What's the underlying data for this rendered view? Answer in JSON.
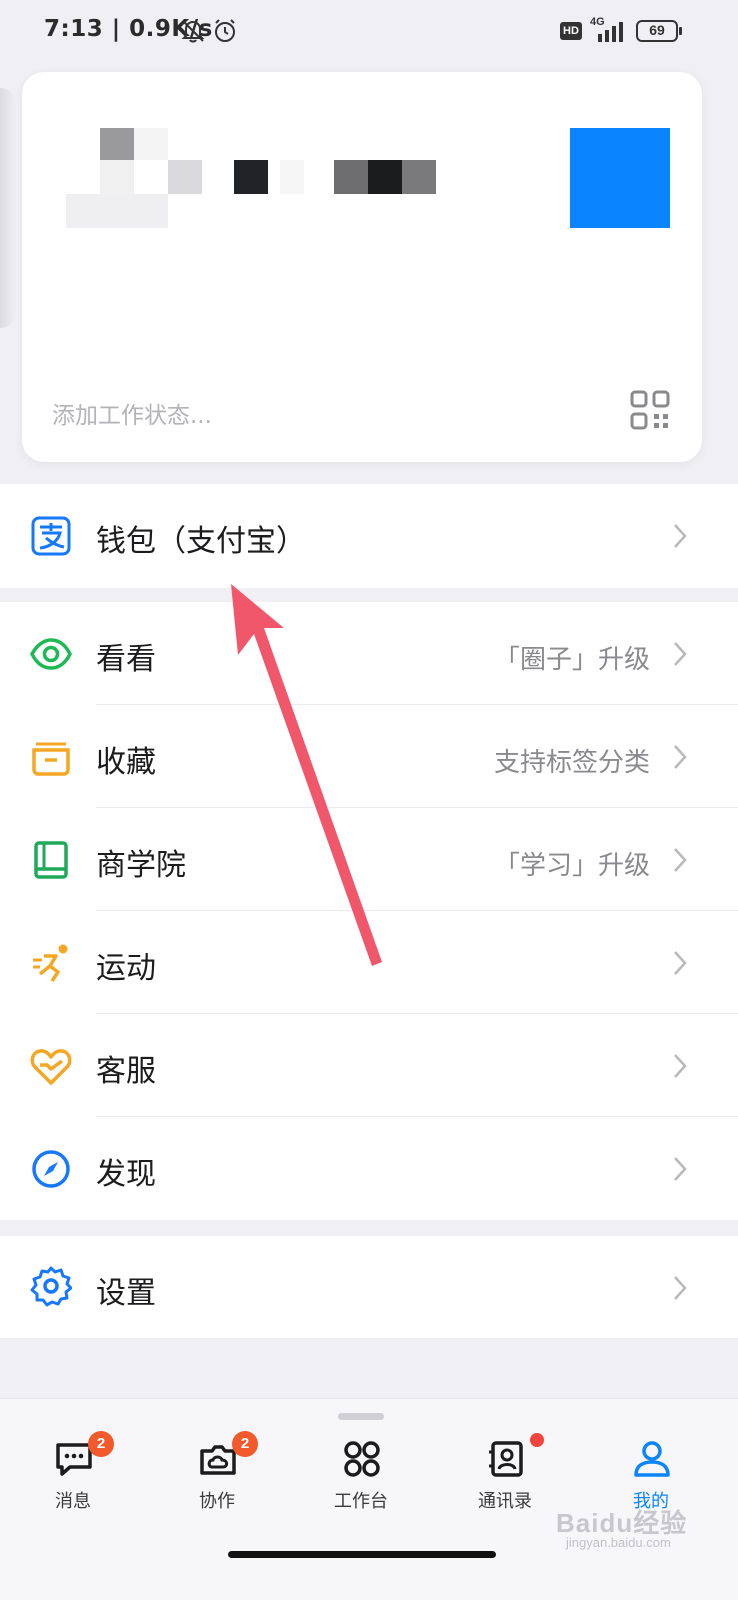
{
  "status_bar": {
    "time_speed": "7:13 | 0.9K/s",
    "hd": "HD",
    "network": "4G",
    "battery": "69"
  },
  "profile": {
    "status_placeholder": "添加工作状态...",
    "avatar_color": "#0a84ff"
  },
  "wallet_section": {
    "items": [
      {
        "label": "钱包（支付宝）",
        "hint": "",
        "icon": "alipay-icon"
      }
    ]
  },
  "feature_section": {
    "items": [
      {
        "label": "看看",
        "hint": "「圈子」升级",
        "icon": "eye-icon"
      },
      {
        "label": "收藏",
        "hint": "支持标签分类",
        "icon": "folder-icon"
      },
      {
        "label": "商学院",
        "hint": "「学习」升级",
        "icon": "book-icon"
      },
      {
        "label": "运动",
        "hint": "",
        "icon": "running-icon"
      },
      {
        "label": "客服",
        "hint": "",
        "icon": "heart-service-icon"
      },
      {
        "label": "发现",
        "hint": "",
        "icon": "compass-icon"
      }
    ]
  },
  "settings_section": {
    "items": [
      {
        "label": "设置",
        "hint": "",
        "icon": "gear-icon"
      }
    ]
  },
  "tab_bar": {
    "tabs": [
      {
        "label": "消息",
        "badge": "2",
        "icon": "message-icon",
        "active": false
      },
      {
        "label": "协作",
        "badge": "2",
        "icon": "collaboration-icon",
        "active": false
      },
      {
        "label": "工作台",
        "badge": "",
        "icon": "workbench-icon",
        "active": false
      },
      {
        "label": "通讯录",
        "badge": "",
        "icon": "contacts-icon",
        "active": false
      },
      {
        "label": "我的",
        "badge": "",
        "icon": "user-icon",
        "active": true
      }
    ]
  },
  "watermark": {
    "brand": "Baidu经验",
    "url": "jingyan.baidu.com"
  },
  "colors": {
    "accent": "#0a84ff",
    "badge": "#f25a2c",
    "arrow": "#f0576a"
  }
}
